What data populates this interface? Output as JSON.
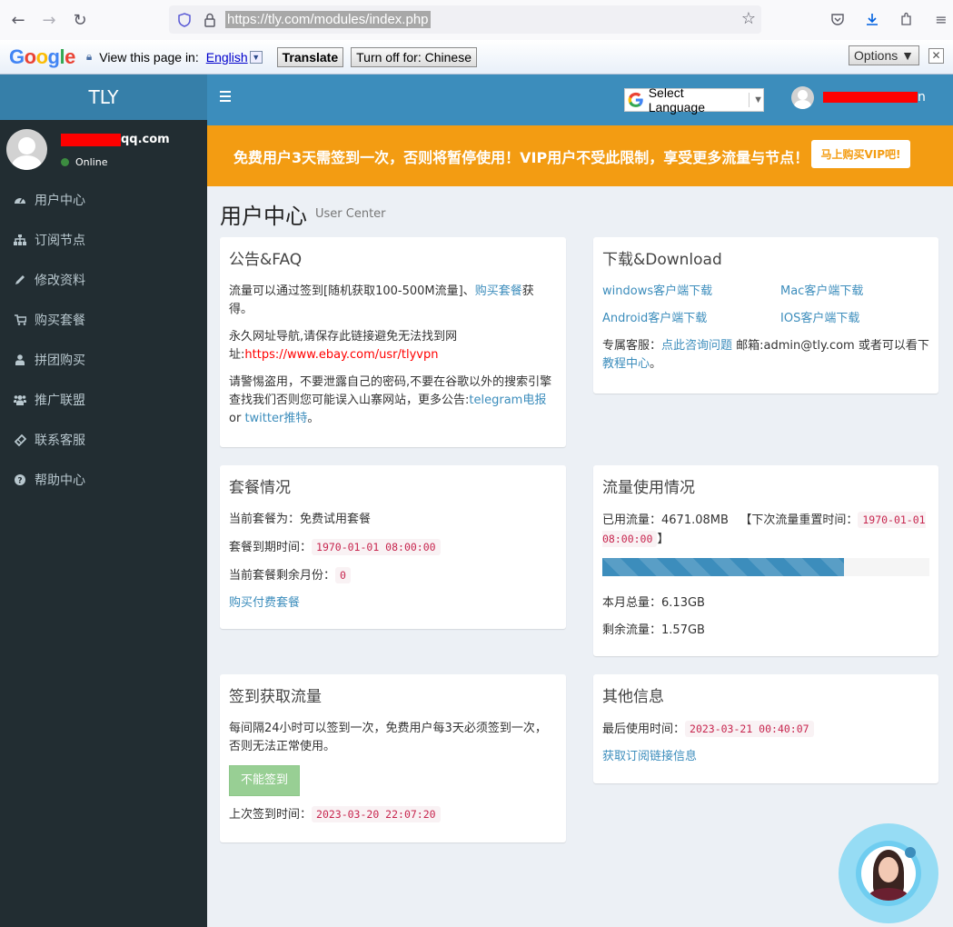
{
  "browser": {
    "url": "https://tly.com/modules/index.php"
  },
  "translate_bar": {
    "label": "View this page in:",
    "language": "English",
    "translate_button": "Translate",
    "turn_off_button": "Turn off for: Chinese",
    "options_button": "Options ▼"
  },
  "sidebar": {
    "brand": "TLY",
    "user_email_suffix": "qq.com",
    "status": "Online",
    "items": [
      {
        "label": "用户中心",
        "icon": "dashboard-icon"
      },
      {
        "label": "订阅节点",
        "icon": "sitemap-icon"
      },
      {
        "label": "修改资料",
        "icon": "pencil-icon"
      },
      {
        "label": "购买套餐",
        "icon": "cart-icon"
      },
      {
        "label": "拼团购买",
        "icon": "user-icon"
      },
      {
        "label": "推广联盟",
        "icon": "users-icon"
      },
      {
        "label": "联系客服",
        "icon": "ticket-icon"
      },
      {
        "label": "帮助中心",
        "icon": "question-circle-icon"
      }
    ]
  },
  "header": {
    "language_select": "Select Language",
    "user_name_suffix": "n"
  },
  "banner": {
    "text": "免费用户3天需签到一次，否则将暂停使用！VIP用户不受此限制，享受更多流量与节点！",
    "button": "马上购买VIP吧!"
  },
  "page": {
    "title": "用户中心",
    "subtitle": "User Center"
  },
  "faq": {
    "title": "公告&FAQ",
    "p1_text": "流量可以通过签到[随机获取100-500M流量]、",
    "p1_link": "购买套餐",
    "p1_end": "获得。",
    "p2_text": "永久网址导航,请保存此链接避免无法找到网址:",
    "p2_link": "https://www.ebay.com/usr/tlyvpn",
    "p3_text": "请警惕盗用，不要泄露自己的密码,不要在谷歌以外的搜索引擎查找我们否则您可能误入山寨网站，更多公告:",
    "p3_link1": "telegram电报",
    "p3_or": " or ",
    "p3_link2": "twitter推特",
    "p3_end": "。"
  },
  "download": {
    "title": "下载&Download",
    "links": [
      "windows客户端下载",
      "Mac客户端下载",
      "Android客户端下载",
      "IOS客户端下载"
    ],
    "support_label": "专属客服：",
    "support_link": "点此咨询问题",
    "email_text": " 邮箱:admin@tly.com  或者可以看下",
    "tutorial_link": "教程中心",
    "end": "。"
  },
  "plan": {
    "title": "套餐情况",
    "current_label": "当前套餐为：",
    "current_value": "免费试用套餐",
    "expire_label": "套餐到期时间：",
    "expire_value": "1970-01-01 08:00:00",
    "months_label": "当前套餐剩余月份：",
    "months_value": "0",
    "buy_link": "购买付费套餐"
  },
  "traffic": {
    "title": "流量使用情况",
    "used_label": "已用流量：",
    "used_value": "4671.08MB",
    "reset_label": "【下次流量重置时间：",
    "reset_value": "1970-01-01 08:00:00",
    "reset_end": "】",
    "usage_percent": 74,
    "total_label": "本月总量：",
    "total_value": "6.13GB",
    "remain_label": "剩余流量：",
    "remain_value": "1.57GB"
  },
  "checkin": {
    "title": "签到获取流量",
    "description": "每间隔24小时可以签到一次，免费用户每3天必须签到一次，否则无法正常使用。",
    "button": "不能签到",
    "last_label": "上次签到时间：",
    "last_value": "2023-03-20 22:07:20"
  },
  "other": {
    "title": "其他信息",
    "last_used_label": "最后使用时间：",
    "last_used_value": "2023-03-21 00:40:07",
    "subscribe_link": "获取订阅链接信息"
  }
}
